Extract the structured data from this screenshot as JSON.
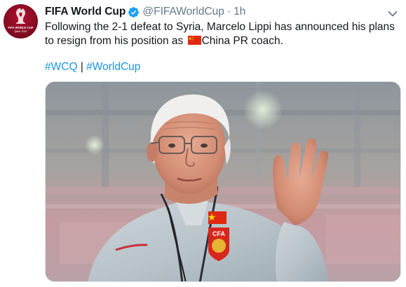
{
  "tweet": {
    "author_name": "FIFA World Cup",
    "verified": true,
    "handle": "@FIFAWorldCup",
    "separator": "·",
    "timestamp": "1h",
    "text_before_flag": "Following the 2-1 defeat to Syria, Marcelo Lippi has announced his plans to resign from his position as",
    "flag_icon": "china-flag-icon",
    "text_after_flag": "China PR coach.",
    "hashtags": [
      "#WCQ",
      "#WorldCup"
    ],
    "hashtag_separator": "|",
    "avatar_text": "FIFA WORLD CUP Qatar 2022",
    "jersey_badge_text": "CFA"
  },
  "colors": {
    "link": "#1b95e0",
    "verified": "#1da1f2",
    "muted": "#657786",
    "text": "#14171a",
    "avatar_bg": "#8a0c23",
    "flag_red": "#de2910",
    "flag_yellow": "#ffde00"
  },
  "icons": {
    "verified": "verified-badge-icon",
    "caret": "chevron-down-icon",
    "avatar": "fifa-world-cup-logo"
  }
}
